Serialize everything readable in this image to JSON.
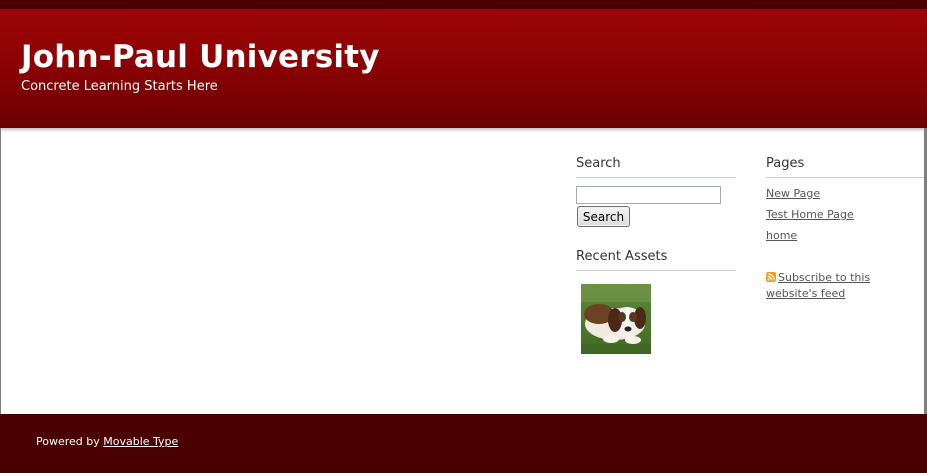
{
  "header": {
    "site_title": "John-Paul University",
    "site_description": "Concrete Learning Starts Here"
  },
  "search_widget": {
    "title": "Search",
    "input_value": "",
    "button_label": "Search"
  },
  "recent_assets": {
    "title": "Recent Assets",
    "items": [
      {
        "icon": "puppy-thumbnail-image"
      }
    ]
  },
  "pages_widget": {
    "title": "Pages",
    "links": [
      "New Page",
      "Test Home Page",
      "home"
    ]
  },
  "feed": {
    "icon": "rss-feed-icon",
    "label": "Subscribe to this website's feed"
  },
  "footer": {
    "powered_by": "Powered by",
    "link_label": "Movable Type"
  },
  "colors": {
    "header_red": "#9e0405",
    "dark_maroon": "#4a0000",
    "link_gray": "#555555"
  }
}
